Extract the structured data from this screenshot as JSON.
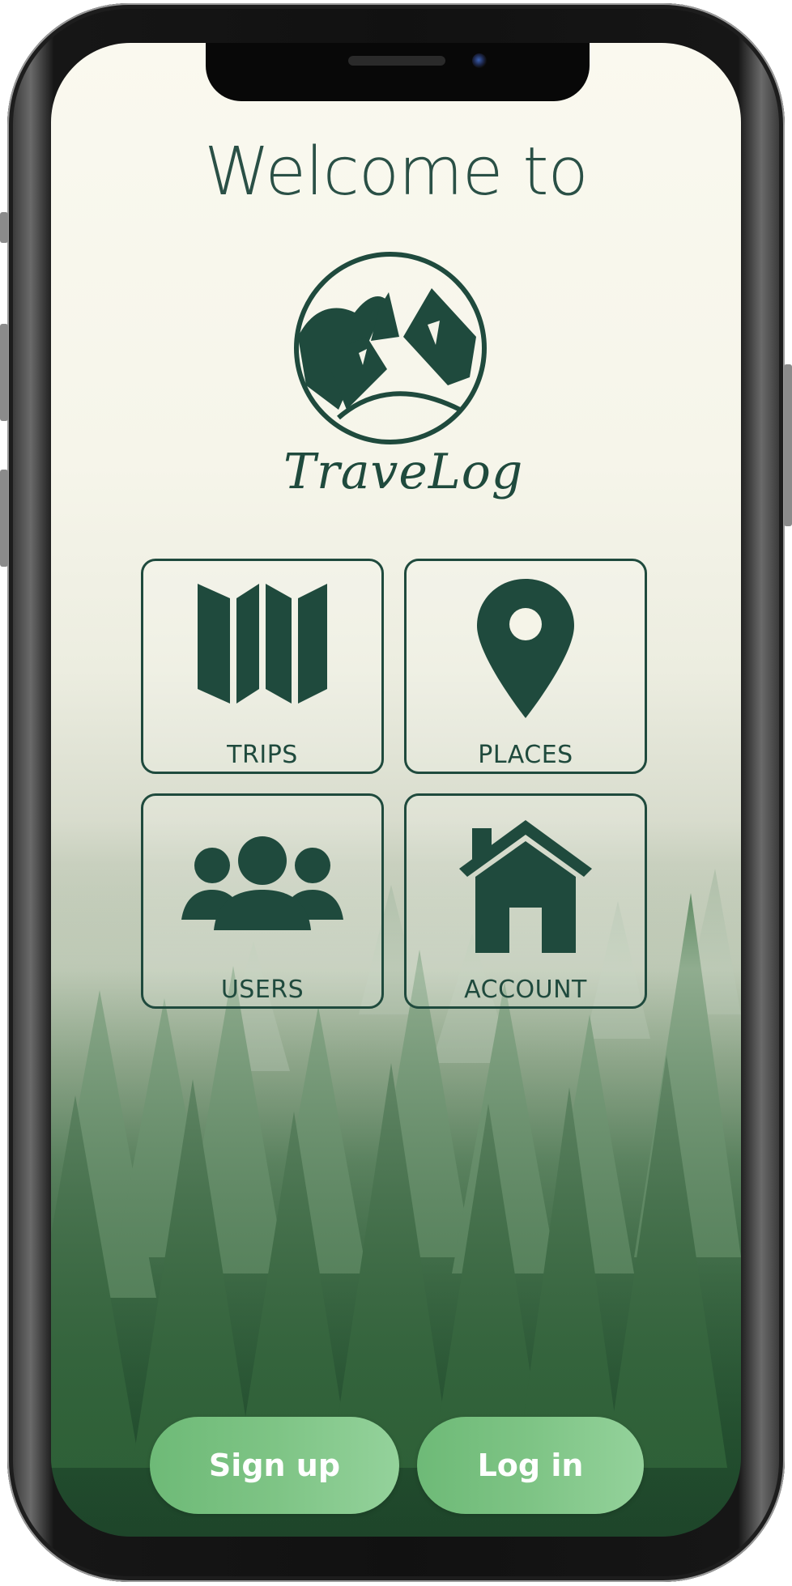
{
  "header": {
    "welcome_text": "Welcome to",
    "brand_name": "TraveLog"
  },
  "menu": {
    "tiles": [
      {
        "label": "TRIPS",
        "icon": "map-icon"
      },
      {
        "label": "PLACES",
        "icon": "location-pin-icon"
      },
      {
        "label": "USERS",
        "icon": "users-icon"
      },
      {
        "label": "ACCOUNT",
        "icon": "home-icon"
      }
    ]
  },
  "actions": {
    "signup_label": "Sign up",
    "login_label": "Log in"
  },
  "colors": {
    "primary": "#1f4a3d",
    "button": "#7ec485"
  }
}
